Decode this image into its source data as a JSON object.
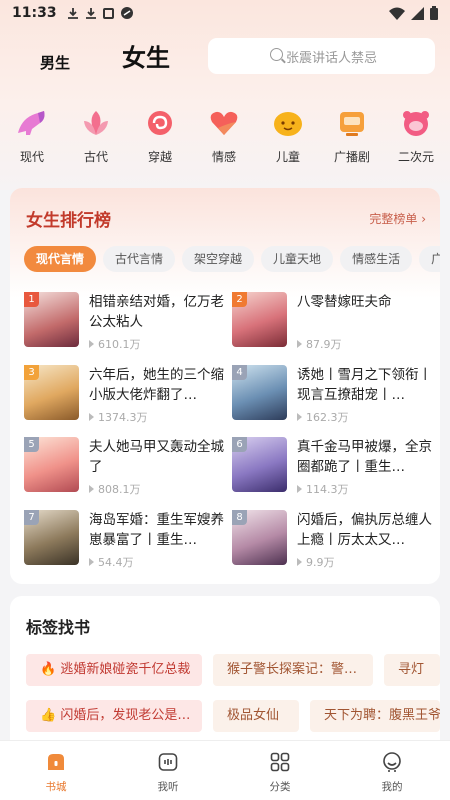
{
  "status": {
    "time": "11:33"
  },
  "header": {
    "tab_male": "男生",
    "tab_female": "女生",
    "search_placeholder": "张震讲话人禁忌"
  },
  "categories": [
    {
      "label": "现代",
      "icon": "high-heel-icon"
    },
    {
      "label": "古代",
      "icon": "lotus-icon"
    },
    {
      "label": "穿越",
      "icon": "portal-swirl-icon"
    },
    {
      "label": "情感",
      "icon": "heart-icon"
    },
    {
      "label": "儿童",
      "icon": "smiley-face-icon"
    },
    {
      "label": "广播剧",
      "icon": "radio-icon"
    },
    {
      "label": "二次元",
      "icon": "anime-character-icon"
    }
  ],
  "ranking": {
    "title": "女生排行榜",
    "more": "完整榜单",
    "chips": [
      "现代言情",
      "古代言情",
      "架空穿越",
      "儿童天地",
      "情感生活",
      "广"
    ],
    "books": [
      {
        "rank": "1",
        "title": "相错亲结对婚，亿万老公太粘人",
        "count": "610.1万"
      },
      {
        "rank": "2",
        "title": "八零替嫁旺夫命",
        "count": "87.9万"
      },
      {
        "rank": "3",
        "title": "六年后，她生的三个缩小版大佬炸翻了…",
        "count": "1374.3万"
      },
      {
        "rank": "4",
        "title": "诱她丨雪月之下领衔丨现言互撩甜宠丨…",
        "count": "162.3万"
      },
      {
        "rank": "5",
        "title": "夫人她马甲又轰动全城了",
        "count": "808.1万"
      },
      {
        "rank": "6",
        "title": "真千金马甲被爆，全京圈都跪了丨重生…",
        "count": "114.3万"
      },
      {
        "rank": "7",
        "title": "海岛军婚：重生军嫂养崽暴富了丨重生…",
        "count": "54.4万"
      },
      {
        "rank": "8",
        "title": "闪婚后，偏执厉总缠人上瘾丨厉太太又…",
        "count": "9.9万"
      }
    ]
  },
  "tags": {
    "title": "标签找书",
    "row1": [
      {
        "label": "逃婚新娘碰瓷千亿总裁",
        "icon": "fire-icon"
      },
      {
        "label": "猴子警长探案记：警…"
      },
      {
        "label": "寻灯"
      }
    ],
    "row2": [
      {
        "label": "闪婚后，发现老公是…",
        "icon": "thumbs-up-icon"
      },
      {
        "label": "极品女仙"
      },
      {
        "label": "天下为聘：腹黑王爷"
      }
    ]
  },
  "nav": [
    {
      "label": "书城",
      "icon": "bookstore-icon",
      "active": true
    },
    {
      "label": "我听",
      "icon": "listen-icon"
    },
    {
      "label": "分类",
      "icon": "grid-icon"
    },
    {
      "label": "我的",
      "icon": "profile-icon"
    }
  ],
  "colors": {
    "accent": "#f28a3e",
    "rank_title": "#c23a2b",
    "hot_tag_bg": "#fde7e6"
  }
}
